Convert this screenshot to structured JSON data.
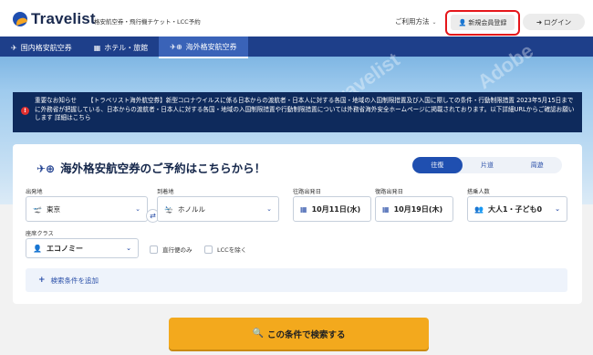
{
  "header": {
    "logo_text": "Travelist",
    "tagline": "格安航空券・飛行機チケット・LCC予約",
    "usage_label": "ご利用方法",
    "register_label": "新規会員登録",
    "login_label": "ログイン"
  },
  "nav": {
    "items": [
      {
        "label": "国内格安航空券",
        "icon": "plane-icon"
      },
      {
        "label": "ホテル・旅館",
        "icon": "hotel-icon"
      },
      {
        "label": "海外格安航空券",
        "icon": "globe-plane-icon"
      }
    ],
    "active_index": 2
  },
  "notice": {
    "label": "重要なお知らせ",
    "text": "【トラベリスト海外航空券】新型コロナウイルスに係る日本からの渡航者・日本人に対する各国・地域の入国制限措置及び入国に際しての条件・行動制限措置 2023年5月15日までに外務省が把握している、日本からの渡航者・日本人に対する各国・地域の入国制限措置や行動制限措置については外務省海外安全ホームページに掲載されております。以下詳細URLからご確認お願いします 詳細はこちら"
  },
  "search": {
    "title": "海外格安航空券のご予約はこちらから！",
    "trip_tabs": [
      "往復",
      "片道",
      "周遊"
    ],
    "active_trip": 0,
    "departure_label": "出発地",
    "departure_value": "東京",
    "arrival_label": "到着地",
    "arrival_value": "ホノルル",
    "outbound_label": "往路出発日",
    "outbound_value": "10月11日(水)",
    "return_label": "復路出発日",
    "return_value": "10月19日(木)",
    "pax_label": "搭乗人数",
    "pax_value": "大人1・子ども0",
    "class_label": "座席クラス",
    "class_value": "エコノミー",
    "direct_only": "直行便のみ",
    "exclude_lcc": "LCCを除く",
    "add_conditions": "検索条件を追加",
    "search_button": "この条件で検索する"
  },
  "colors": {
    "brand_navy": "#1e3f8a",
    "accent_orange": "#f3a91d",
    "highlight_red": "#e5161b"
  }
}
